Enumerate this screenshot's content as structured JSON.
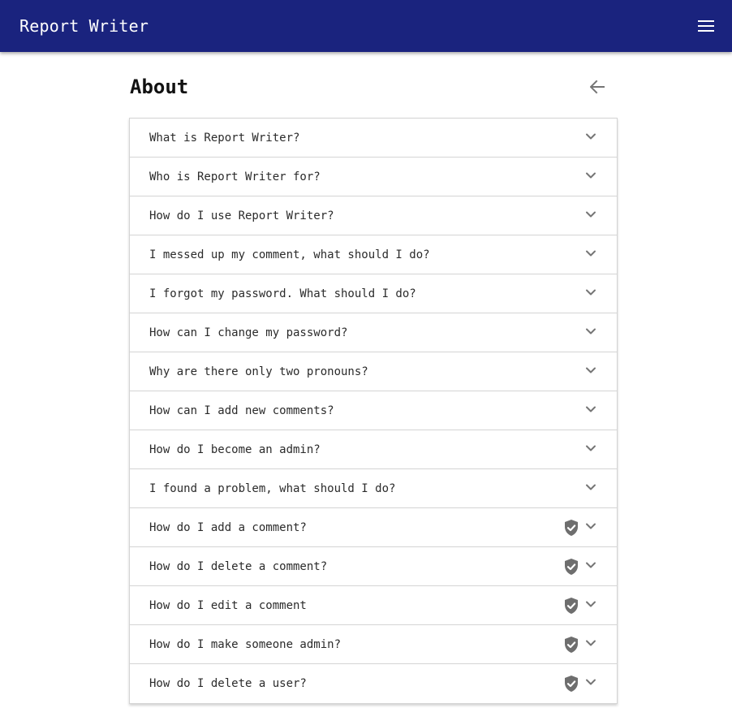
{
  "app": {
    "title": "Report Writer"
  },
  "header": {
    "menu_icon": "menu-icon"
  },
  "page": {
    "title": "About",
    "back_icon": "arrow-back-icon"
  },
  "colors": {
    "appbar": "#1a237e",
    "icon_gray": "#757575",
    "shield": "#6e6e6e"
  },
  "faq": [
    {
      "question": "What is Report Writer?",
      "admin": false
    },
    {
      "question": "Who is Report Writer for?",
      "admin": false
    },
    {
      "question": "How do I use Report Writer?",
      "admin": false
    },
    {
      "question": "I messed up my comment, what should I do?",
      "admin": false
    },
    {
      "question": "I forgot my password. What should I do?",
      "admin": false
    },
    {
      "question": "How can I change my password?",
      "admin": false
    },
    {
      "question": "Why are there only two pronouns?",
      "admin": false
    },
    {
      "question": "How can I add new comments?",
      "admin": false
    },
    {
      "question": "How do I become an admin?",
      "admin": false
    },
    {
      "question": "I found a problem, what should I do?",
      "admin": false
    },
    {
      "question": "How do I add a comment?",
      "admin": true
    },
    {
      "question": "How do I delete a comment?",
      "admin": true
    },
    {
      "question": "How do I edit a comment",
      "admin": true
    },
    {
      "question": "How do I make someone admin?",
      "admin": true
    },
    {
      "question": "How do I delete a user?",
      "admin": true
    }
  ]
}
